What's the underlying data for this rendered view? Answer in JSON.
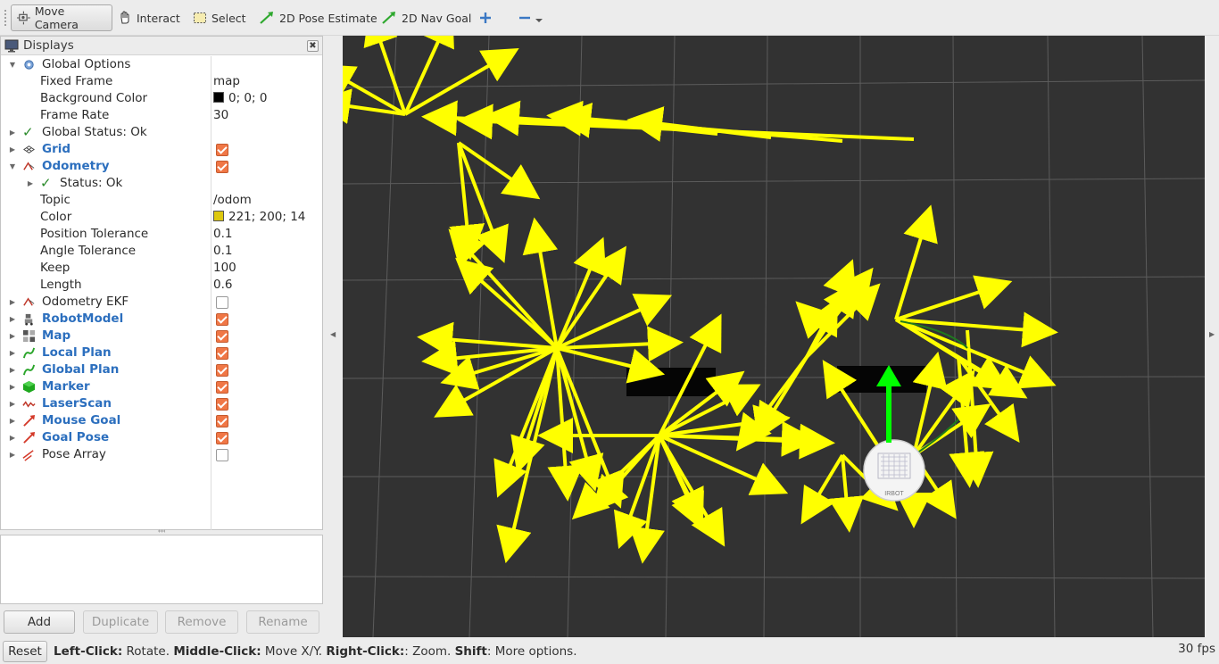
{
  "toolbar": {
    "tools": [
      {
        "label": "Move Camera",
        "icon": "move-camera-icon",
        "active": true
      },
      {
        "label": "Interact",
        "icon": "hand-icon"
      },
      {
        "label": "Select",
        "icon": "select-box-icon"
      },
      {
        "label": "2D Pose Estimate",
        "icon": "pose-arrow-icon"
      },
      {
        "label": "2D Nav Goal",
        "icon": "nav-arrow-icon"
      }
    ],
    "add_icon": "plus-icon",
    "remove_icon": "minus-icon",
    "dropdown_icon": "chevron-down-icon"
  },
  "displays": {
    "title": "Displays",
    "close_symbol": "✖",
    "rows": [
      {
        "label": "Global Options"
      },
      {
        "label": "Fixed Frame",
        "value": "map"
      },
      {
        "label": "Background Color",
        "value": "0; 0; 0",
        "swatch": "#000000"
      },
      {
        "label": "Frame Rate",
        "value": "30"
      },
      {
        "label": "Global Status: Ok"
      },
      {
        "label": "Grid",
        "checked": true
      },
      {
        "label": "Odometry",
        "checked": true
      },
      {
        "label": "Status: Ok"
      },
      {
        "label": "Topic",
        "value": "/odom"
      },
      {
        "label": "Color",
        "value": "221; 200; 14",
        "swatch": "#ddc80e"
      },
      {
        "label": "Position Tolerance",
        "value": "0.1"
      },
      {
        "label": "Angle Tolerance",
        "value": "0.1"
      },
      {
        "label": "Keep",
        "value": "100"
      },
      {
        "label": "Length",
        "value": "0.6"
      },
      {
        "label": "Odometry EKF",
        "checked": false
      },
      {
        "label": "RobotModel",
        "checked": true
      },
      {
        "label": "Map",
        "checked": true
      },
      {
        "label": "Local Plan",
        "checked": true
      },
      {
        "label": "Global Plan",
        "checked": true
      },
      {
        "label": "Marker",
        "checked": true
      },
      {
        "label": "LaserScan",
        "checked": true
      },
      {
        "label": "Mouse Goal",
        "checked": true
      },
      {
        "label": "Goal Pose",
        "checked": true
      },
      {
        "label": "Pose Array",
        "checked": false
      }
    ]
  },
  "panel_buttons": {
    "add": "Add",
    "duplicate": "Duplicate",
    "remove": "Remove",
    "rename": "Rename"
  },
  "viewport": {
    "background": "#323232",
    "grid_color": "#5a5a5a",
    "arrow_color": "#ffff00",
    "goal_arrow_color": "#00ff00",
    "robot_label": "IRBOT"
  },
  "status": {
    "reset": "Reset",
    "hint_parts": [
      {
        "b": "Left-Click:",
        "t": " Rotate. "
      },
      {
        "b": "Middle-Click:",
        "t": " Move X/Y. "
      },
      {
        "b": "Right-Click:",
        "t": ": Zoom. "
      },
      {
        "b": "Shift",
        "t": ": More options."
      }
    ],
    "fps": "30 fps"
  }
}
